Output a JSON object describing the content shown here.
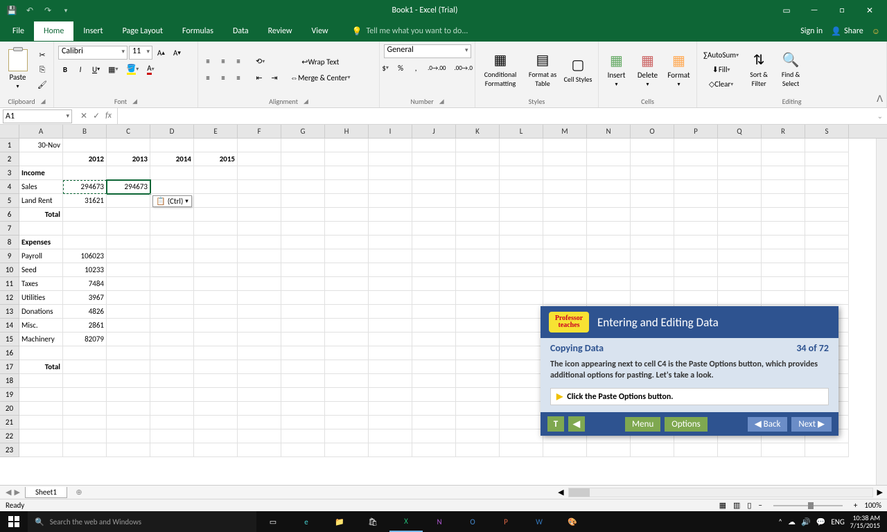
{
  "window": {
    "title": "Book1 - Excel (Trial)"
  },
  "account": {
    "signin": "Sign in",
    "share": "Share"
  },
  "tellme": "Tell me what you want to do...",
  "tabs": {
    "file": "File",
    "home": "Home",
    "insert": "Insert",
    "pagelayout": "Page Layout",
    "formulas": "Formulas",
    "data": "Data",
    "review": "Review",
    "view": "View"
  },
  "ribbon": {
    "clipboard": {
      "label": "Clipboard",
      "paste": "Paste"
    },
    "font": {
      "label": "Font",
      "name": "Calibri",
      "size": "11"
    },
    "alignment": {
      "label": "Alignment",
      "wrap": "Wrap Text",
      "merge": "Merge & Center"
    },
    "number": {
      "label": "Number",
      "format": "General"
    },
    "styles": {
      "label": "Styles",
      "cond": "Conditional Formatting",
      "table": "Format as Table",
      "cell": "Cell Styles"
    },
    "cells": {
      "label": "Cells",
      "insert": "Insert",
      "delete": "Delete",
      "format": "Format"
    },
    "editing": {
      "label": "Editing",
      "sum": "AutoSum",
      "fill": "Fill",
      "clear": "Clear",
      "sort": "Sort & Filter",
      "find": "Find & Select"
    }
  },
  "namebox": "A1",
  "fx_symbol": "fx",
  "columns": [
    "A",
    "B",
    "C",
    "D",
    "E",
    "F",
    "G",
    "H",
    "I",
    "J",
    "K",
    "L",
    "M",
    "N",
    "O",
    "P",
    "Q",
    "R",
    "S"
  ],
  "cells": {
    "A1": "30-Nov",
    "B2": "2012",
    "C2": "2013",
    "D2": "2014",
    "E2": "2015",
    "A3": "Income",
    "A4": "Sales",
    "B4": "294673",
    "C4": "294673",
    "A5": "Land Rent",
    "B5": "31621",
    "A6": "Total",
    "A8": "Expenses",
    "A9": "Payroll",
    "B9": "106023",
    "A10": "Seed",
    "B10": "10233",
    "A11": "Taxes",
    "B11": "7484",
    "A12": "Utilities",
    "B12": "3967",
    "A13": "Donations",
    "B13": "4826",
    "A14": "Misc.",
    "B14": "2861",
    "A15": "Machinery",
    "B15": "82079",
    "A17": "Total"
  },
  "paste_options": "(Ctrl)",
  "sheet": {
    "name": "Sheet1"
  },
  "status": {
    "ready": "Ready",
    "zoom": "100%"
  },
  "tutorial": {
    "brand": "Professor teaches",
    "title": "Entering and Editing Data",
    "subtitle": "Copying Data",
    "progress": "34 of 72",
    "text": "The icon appearing next to cell C4 is the Paste Options button, which provides additional options for pasting. Let's take a look.",
    "action": "Click the Paste Options button.",
    "menu": "Menu",
    "options": "Options",
    "back": "Back",
    "next": "Next"
  },
  "taskbar": {
    "search": "Search the web and Windows",
    "lang": "ENG",
    "time": "10:38 AM",
    "date": "7/15/2015"
  }
}
